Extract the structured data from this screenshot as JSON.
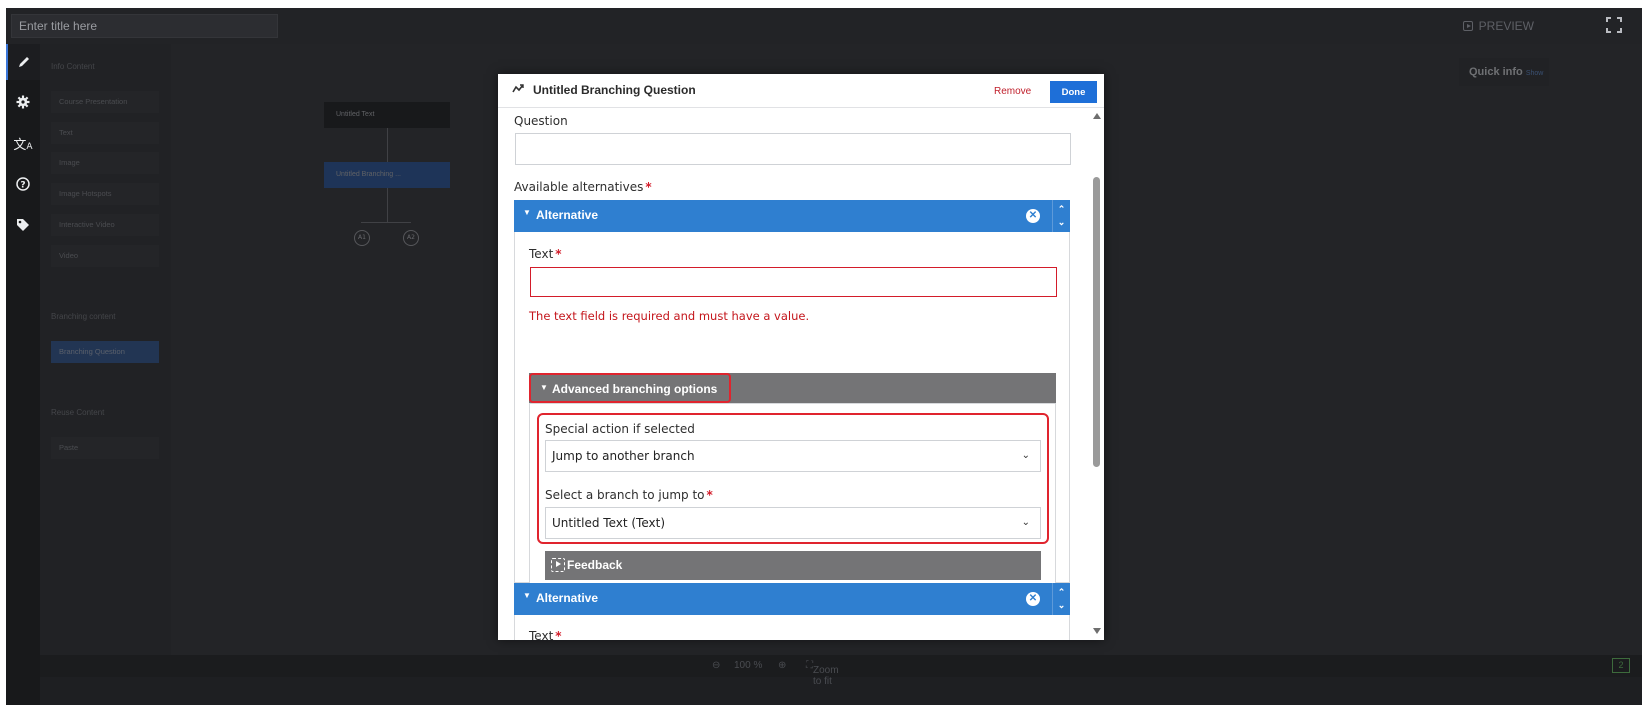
{
  "topbar": {
    "title_placeholder": "Enter title here",
    "preview_label": "PREVIEW"
  },
  "rail": {
    "items": [
      "pencil-icon",
      "gear-icon",
      "translate-icon",
      "help-icon",
      "tag-icon"
    ]
  },
  "panel": {
    "info_content_label": "Info Content",
    "info_items": [
      "Course Presentation",
      "Text",
      "Image",
      "Image Hotspots",
      "Interactive Video",
      "Video"
    ],
    "branching_content_label": "Branching content",
    "branching_items": [
      "Branching Question"
    ],
    "reuse_content_label": "Reuse Content",
    "reuse_items": [
      "Paste"
    ]
  },
  "canvas": {
    "nodes": [
      "Untitled Text",
      "Untitled Branching ..."
    ],
    "alternatives": [
      "A1",
      "A2"
    ],
    "quick_info_label": "Quick info",
    "quick_info_show": "Show"
  },
  "bottombar": {
    "zoom_level": "100 %",
    "zoom_to_fit": "Zoom to fit",
    "chip": "2"
  },
  "modal": {
    "title": "Untitled Branching Question",
    "remove_label": "Remove",
    "done_label": "Done",
    "question_label": "Question",
    "question_value": "",
    "available_alternatives_label": "Available alternatives",
    "required_mark": "*",
    "alternatives": [
      {
        "header": "Alternative",
        "text_label": "Text",
        "text_value": "",
        "error_message": "The text field is required and must have a value.",
        "advanced_label": "Advanced branching options",
        "special_action_label": "Special action if selected",
        "special_action_value": "Jump to another branch",
        "branch_select_label": "Select a branch to jump to",
        "branch_select_value": "Untitled Text (Text)",
        "feedback_label": "Feedback"
      },
      {
        "header": "Alternative",
        "text_label": "Text"
      }
    ]
  },
  "colors": {
    "accent": "#2f7fd0",
    "done_button": "#1e6fd8",
    "error": "#d31c2a",
    "highlight_box": "#e0242e"
  }
}
